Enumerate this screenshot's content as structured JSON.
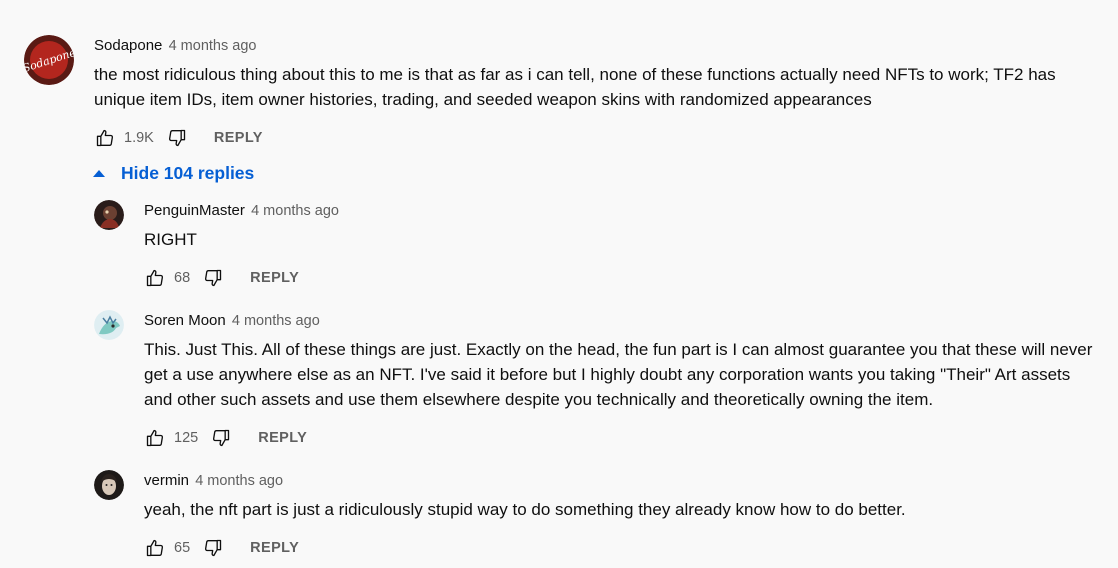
{
  "top_comment": {
    "author": "Sodapone",
    "time": "4 months ago",
    "avatar_text": "Sodapone",
    "text": "the most ridiculous thing about this to me is that as far as i can tell, none of these functions actually need NFTs to work; TF2 has unique item IDs, item owner histories, trading, and seeded weapon skins with randomized appearances",
    "likes": "1.9K",
    "reply_label": "REPLY"
  },
  "hide_replies_label": "Hide 104 replies",
  "replies": [
    {
      "author": "PenguinMaster",
      "time": "4 months ago",
      "text": "RIGHT",
      "likes": "68",
      "reply_label": "REPLY"
    },
    {
      "author": "Soren Moon",
      "time": "4 months ago",
      "text": "This. Just This. All of these things are just. Exactly on the head, the fun part is I can almost guarantee you that these will never get a use anywhere else as an NFT. I've said it before but I highly doubt any corporation wants you taking \"Their\" Art assets and other such assets and use them elsewhere despite you technically and theoretically owning the item.",
      "likes": "125",
      "reply_label": "REPLY"
    },
    {
      "author": "vermin",
      "time": "4 months ago",
      "text": "yeah, the nft part is just a ridiculously stupid way to do something they already know how to do better.",
      "likes": "65",
      "reply_label": "REPLY"
    }
  ],
  "colors": {
    "background": "#f9f9f9",
    "link_blue": "#065fd4",
    "secondary_text": "#606060"
  }
}
